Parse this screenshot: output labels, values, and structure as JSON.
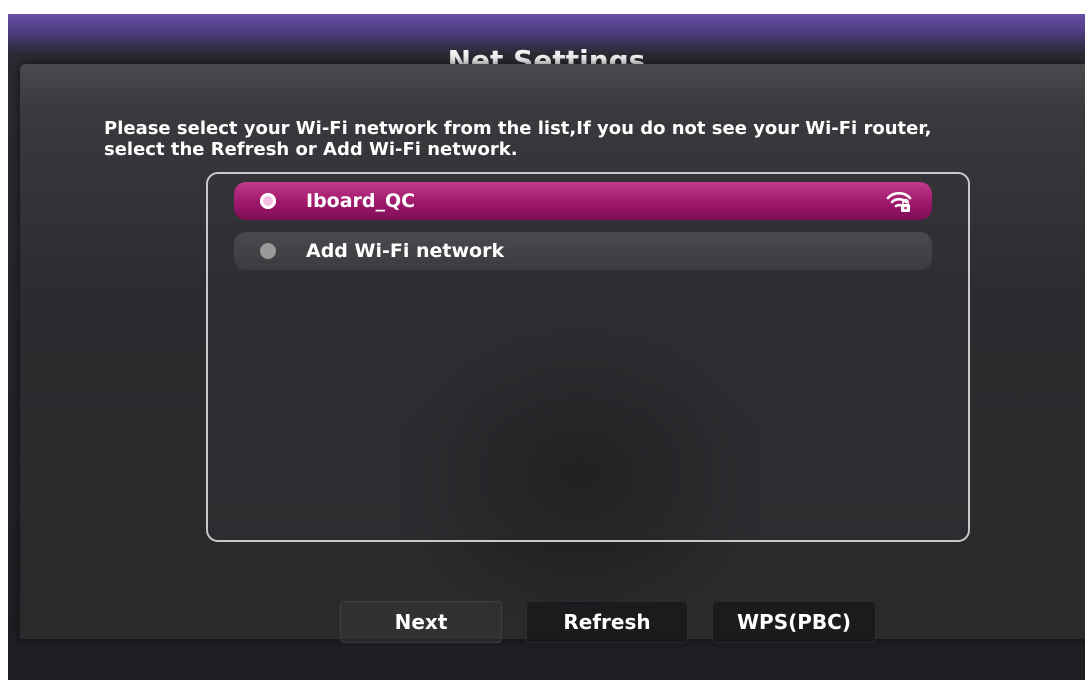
{
  "header": {
    "title": "Net Settings"
  },
  "instruction": {
    "line1": "Please select your Wi-Fi network from the list,If you do not see your Wi-Fi router,",
    "line2": "select the Refresh or Add Wi-Fi network."
  },
  "networks": [
    {
      "label": "Iboard_QC",
      "selected": true,
      "icon": "wifi-locked-icon"
    },
    {
      "label": "Add Wi-Fi network",
      "selected": false
    }
  ],
  "buttons": {
    "next": "Next",
    "refresh": "Refresh",
    "wps": "WPS(PBC)"
  },
  "colors": {
    "accent": "#a21a6e",
    "dialog": "#2c2c30"
  }
}
